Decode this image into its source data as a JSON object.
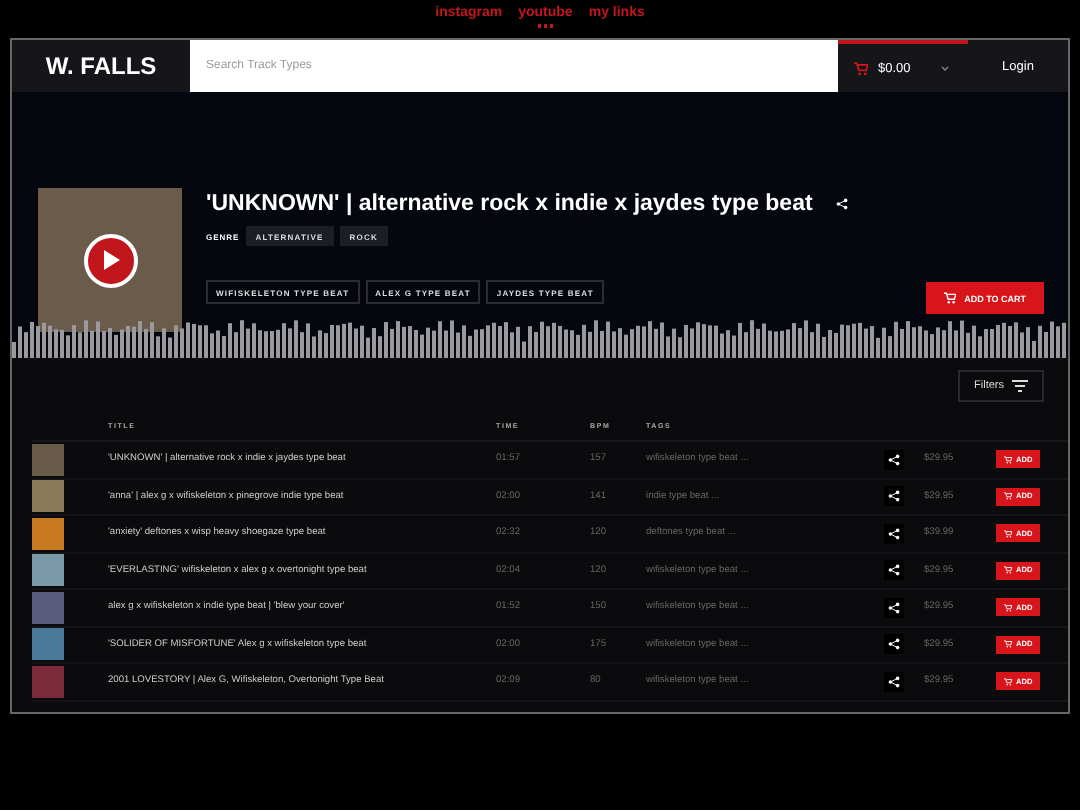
{
  "top_links": [
    {
      "label": "instagram",
      "selected": false
    },
    {
      "label": "youtube",
      "selected": true
    },
    {
      "label": "my links",
      "selected": false
    }
  ],
  "header": {
    "logo": "W. FALLS",
    "search": {
      "placeholder": "Search Track Types"
    },
    "cart": "$0.00",
    "login": "Login"
  },
  "featured": {
    "title": "'UNKNOWN' | alternative rock x indie x jaydes type beat",
    "genre_label": "GENRE",
    "genres": [
      "ALTERNATIVE",
      "ROCK"
    ],
    "tags": [
      "WIFISKELETON TYPE BEAT",
      "ALEX G TYPE BEAT",
      "JAYDES TYPE BEAT"
    ],
    "add_to_cart": "ADD TO CART"
  },
  "filters": "Filters",
  "table": {
    "columns": [
      "TITLE",
      "TIME",
      "BPM",
      "TAGS"
    ],
    "rows": [
      {
        "title": "'UNKNOWN' | alternative rock x indie x jaydes type beat",
        "time": "01:57",
        "bpm": "157",
        "tags": "wifiskeleton type beat ...",
        "price": "$29.95",
        "add": "ADD",
        "color": "#6a5a4a"
      },
      {
        "title": "'anna' | alex g x wifiskeleton x pinegrove indie type beat",
        "time": "02:00",
        "bpm": "141",
        "tags": "indie type beat ...",
        "price": "$29.95",
        "add": "ADD",
        "color": "#8a7a5a"
      },
      {
        "title": "'anxiety' deftones x wisp heavy shoegaze type beat",
        "time": "02:32",
        "bpm": "120",
        "tags": "deftones type beat ...",
        "price": "$39.99",
        "add": "ADD",
        "color": "#c87a20"
      },
      {
        "title": "'EVERLASTING' wifiskeleton x alex g x overtonight type beat",
        "time": "02:04",
        "bpm": "120",
        "tags": "wifiskeleton type beat ...",
        "price": "$29.95",
        "add": "ADD",
        "color": "#7a9aaa"
      },
      {
        "title": "alex g x wifiskeleton x indie type beat | 'blew your cover'",
        "time": "01:52",
        "bpm": "150",
        "tags": "wifiskeleton type beat ...",
        "price": "$29.95",
        "add": "ADD",
        "color": "#5a5a7a"
      },
      {
        "title": "'SOLIDER OF MISFORTUNE' Alex g x wifiskeleton type beat",
        "time": "02:00",
        "bpm": "175",
        "tags": "wifiskeleton type beat ...",
        "price": "$29.95",
        "add": "ADD",
        "color": "#4a7a9a"
      },
      {
        "title": "2001 LOVESTORY | Alex G, Wifiskeleton, Overtonight Type Beat",
        "time": "02:09",
        "bpm": "80",
        "tags": "wifiskeleton type beat ...",
        "price": "$29.95",
        "add": "ADD",
        "color": "#7a2a3a"
      }
    ]
  }
}
